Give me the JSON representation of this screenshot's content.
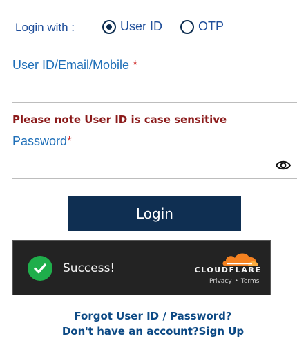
{
  "login_with": {
    "label": "Login with :",
    "options": [
      {
        "label": "User ID",
        "selected": true
      },
      {
        "label": "OTP",
        "selected": false
      }
    ]
  },
  "user_field": {
    "label": "User ID/Email/Mobile",
    "required_mark": "*",
    "value": "",
    "note": "Please note User ID is case sensitive"
  },
  "password_field": {
    "label": "Password",
    "required_mark": "*",
    "value": "",
    "icon": "eye-icon"
  },
  "login_button": {
    "label": "Login"
  },
  "cloudflare": {
    "status": "Success!",
    "brand": "CLOUDFLARE",
    "privacy": "Privacy",
    "separator": "•",
    "terms": "Terms",
    "colors": {
      "success": "#1fae4b",
      "cloud_orange": "#f48120",
      "cloud_light": "#fbad41"
    }
  },
  "links": {
    "forgot": "Forgot User ID / Password?",
    "no_account": "Don't have an account?",
    "signup": "Sign Up"
  },
  "colors": {
    "primary_button": "#0f2f52",
    "label_blue": "#1f6fb8",
    "note_red": "#8b1a1a",
    "link_blue": "#0d4a85"
  }
}
